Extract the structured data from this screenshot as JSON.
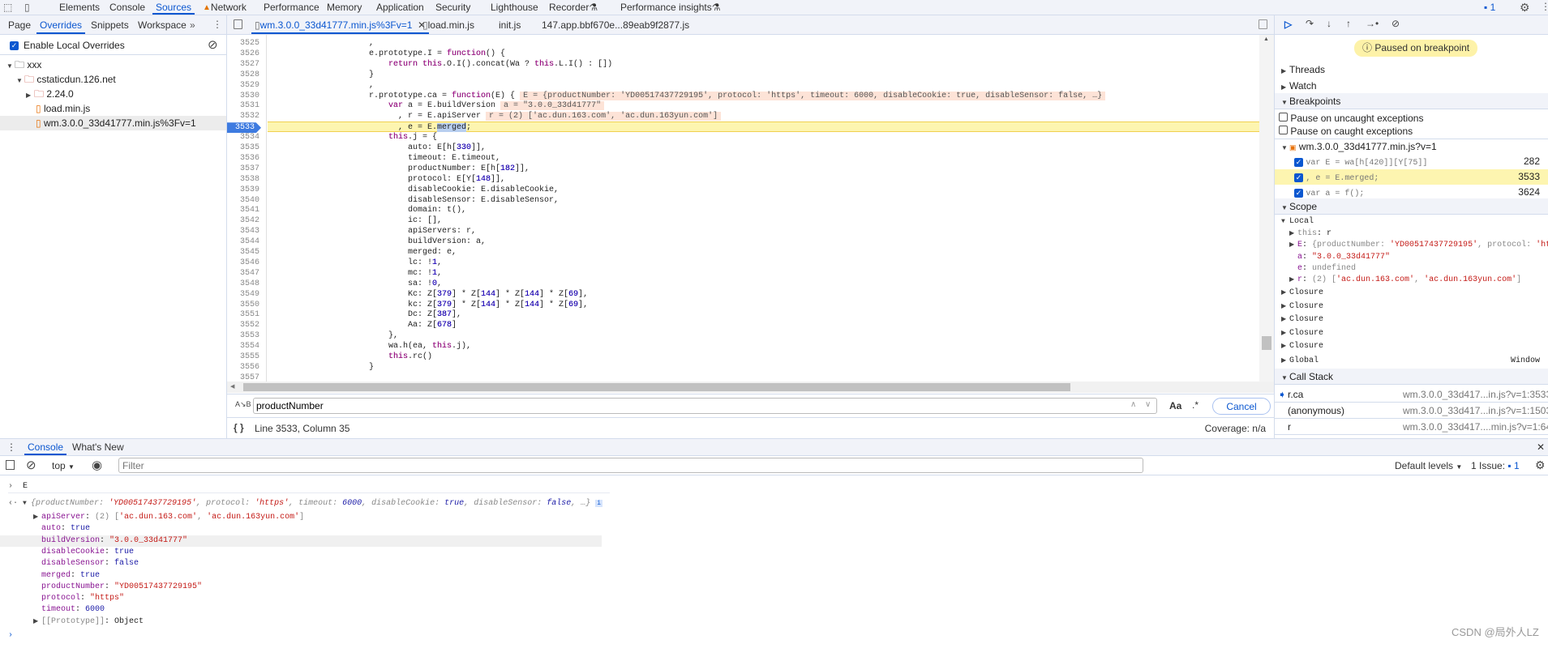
{
  "top_tabs": [
    "Elements",
    "Console",
    "Sources",
    "Network",
    "Performance",
    "Memory",
    "Application",
    "Security",
    "Lighthouse",
    "Recorder",
    "Performance insights"
  ],
  "top_selected": "Sources",
  "issues_count": "1",
  "nav_tabs": [
    "Page",
    "Overrides",
    "Snippets",
    "Workspace"
  ],
  "enable_overrides": "Enable Local Overrides",
  "tree": [
    {
      "label": "xxx",
      "type": "folder",
      "open": true,
      "depth": 0
    },
    {
      "label": "cstaticdun.126.net",
      "type": "folder",
      "open": true,
      "depth": 1
    },
    {
      "label": "2.24.0",
      "type": "folder",
      "open": false,
      "depth": 2
    },
    {
      "label": "load.min.js",
      "type": "file",
      "depth": 2
    },
    {
      "label": "wm.3.0.0_33d41777.min.js%3Fv=1",
      "type": "file",
      "depth": 2,
      "selected": true
    }
  ],
  "file_tabs": [
    {
      "label": "wm.3.0.0_33d41777.min.js%3Fv=1",
      "active": true,
      "closable": true
    },
    {
      "label": "load.min.js"
    },
    {
      "label": "init.js"
    },
    {
      "label": "147.app.bbf670e...89eab9f2877.js"
    }
  ],
  "code": {
    "current_line": 3533,
    "lines": [
      {
        "n": 3525,
        "t": "                    ,"
      },
      {
        "n": 3526,
        "t": "                    e.prototype.I = function() {"
      },
      {
        "n": 3527,
        "t": "                        return this.O.I().concat(Wa ? this.L.I() : [])"
      },
      {
        "n": 3528,
        "t": "                    }"
      },
      {
        "n": 3529,
        "t": "                    ,"
      },
      {
        "n": 3530,
        "t": "                    r.prototype.ca = function(E) {",
        "v": "E = {productNumber: 'YD00517437729195', protocol: 'https', timeout: 6000, disableCookie: true, disableSensor: false, …}"
      },
      {
        "n": 3531,
        "t": "                        var a = E.buildVersion",
        "v": "a = \"3.0.0_33d41777\""
      },
      {
        "n": 3532,
        "t": "                          , r = E.apiServer",
        "v": "r = (2) ['ac.dun.163.com', 'ac.dun.163yun.com']"
      },
      {
        "n": 3533,
        "t": "                          , e = E.merged;",
        "sel": "merged"
      },
      {
        "n": 3534,
        "t": "                        this.j = {"
      },
      {
        "n": 3535,
        "t": "                            auto: E[h[330]],"
      },
      {
        "n": 3536,
        "t": "                            timeout: E.timeout,"
      },
      {
        "n": 3537,
        "t": "                            productNumber: E[h[182]],"
      },
      {
        "n": 3538,
        "t": "                            protocol: E[Y[148]],"
      },
      {
        "n": 3539,
        "t": "                            disableCookie: E.disableCookie,"
      },
      {
        "n": 3540,
        "t": "                            disableSensor: E.disableSensor,"
      },
      {
        "n": 3541,
        "t": "                            domain: t(),"
      },
      {
        "n": 3542,
        "t": "                            ic: [],"
      },
      {
        "n": 3543,
        "t": "                            apiServers: r,"
      },
      {
        "n": 3544,
        "t": "                            buildVersion: a,"
      },
      {
        "n": 3545,
        "t": "                            merged: e,"
      },
      {
        "n": 3546,
        "t": "                            lc: !1,"
      },
      {
        "n": 3547,
        "t": "                            mc: !1,"
      },
      {
        "n": 3548,
        "t": "                            sa: !0,"
      },
      {
        "n": 3549,
        "t": "                            Kc: Z[379] * Z[144] * Z[144] * Z[69],"
      },
      {
        "n": 3550,
        "t": "                            kc: Z[379] * Z[144] * Z[144] * Z[69],"
      },
      {
        "n": 3551,
        "t": "                            Dc: Z[387],"
      },
      {
        "n": 3552,
        "t": "                            Aa: Z[678]"
      },
      {
        "n": 3553,
        "t": "                        },"
      },
      {
        "n": 3554,
        "t": "                        wa.h(ea, this.j),"
      },
      {
        "n": 3555,
        "t": "                        this.rc()"
      },
      {
        "n": 3556,
        "t": "                    }"
      },
      {
        "n": 3557,
        "t": ""
      }
    ]
  },
  "search": {
    "value": "productNumber",
    "case_label": "Aa",
    "regex_label": ".*",
    "cancel": "Cancel"
  },
  "status": {
    "position": "Line 3533, Column 35",
    "coverage": "Coverage: n/a"
  },
  "debugger": {
    "paused": "Paused on breakpoint",
    "threads": "Threads",
    "watch": "Watch",
    "breakpoints": "Breakpoints",
    "pause_uncaught": "Pause on uncaught exceptions",
    "pause_caught": "Pause on caught exceptions",
    "bp_file": "wm.3.0.0_33d41777.min.js?v=1",
    "bps": [
      {
        "code": "var E = wa[h[420]][Y[75]]",
        "line": "282"
      },
      {
        "code": ", e = E.merged;",
        "line": "3533",
        "current": true
      },
      {
        "code": "var a = f();",
        "line": "3624"
      }
    ],
    "scope": "Scope",
    "local": "Local",
    "local_vars": [
      {
        "k": "this",
        "v": "r",
        "exp": true,
        "t": "plain"
      },
      {
        "k": "E",
        "v": "{productNumber: 'YD00517437729195', protocol: 'https', timeout: 6000, disableCookie: true, disableSensor: false, …}",
        "exp": true,
        "t": "obj"
      },
      {
        "k": "a",
        "v": "\"3.0.0_33d41777\"",
        "t": "str"
      },
      {
        "k": "e",
        "v": "undefined",
        "t": "undef"
      },
      {
        "k": "r",
        "v": "(2) ['ac.dun.163.com', 'ac.dun.163yun.com']",
        "exp": true,
        "t": "arr"
      }
    ],
    "closures": [
      "Closure",
      "Closure",
      "Closure",
      "Closure",
      "Closure"
    ],
    "global": "Global",
    "global_value": "Window",
    "call_stack": "Call Stack",
    "frames": [
      {
        "name": "r.ca",
        "loc": "wm.3.0.0_33d417...in.js?v=1:3533",
        "current": true
      },
      {
        "name": "(anonymous)",
        "loc": "wm.3.0.0_33d417...in.js?v=1:1503"
      },
      {
        "name": "r",
        "loc": "wm.3.0.0_33d417....min.js?v=1:64"
      }
    ]
  },
  "drawer": {
    "tabs": [
      "Console",
      "What's New"
    ],
    "context": "top",
    "filter_placeholder": "Filter",
    "levels": "Default levels",
    "issues_label": "1 Issue:",
    "issues_count": "1"
  },
  "console": {
    "input": "E",
    "summary": "{productNumber: 'YD00517437729195', protocol: 'https', timeout: 6000, disableCookie: true, disableSensor: false, …}",
    "props": [
      {
        "k": "apiServer",
        "v": "(2) ['ac.dun.163.com', 'ac.dun.163yun.com']",
        "exp": true,
        "t": "arr"
      },
      {
        "k": "auto",
        "v": "true",
        "t": "b"
      },
      {
        "k": "buildVersion",
        "v": "\"3.0.0_33d41777\"",
        "t": "str",
        "hover": true
      },
      {
        "k": "disableCookie",
        "v": "true",
        "t": "b"
      },
      {
        "k": "disableSensor",
        "v": "false",
        "t": "b"
      },
      {
        "k": "merged",
        "v": "true",
        "t": "b"
      },
      {
        "k": "productNumber",
        "v": "\"YD00517437729195\"",
        "t": "str"
      },
      {
        "k": "protocol",
        "v": "\"https\"",
        "t": "str"
      },
      {
        "k": "timeout",
        "v": "6000",
        "t": "b"
      },
      {
        "k": "[[Prototype]]",
        "v": "Object",
        "exp": true,
        "t": "proto"
      }
    ]
  },
  "watermark": "CSDN @局外人LZ"
}
